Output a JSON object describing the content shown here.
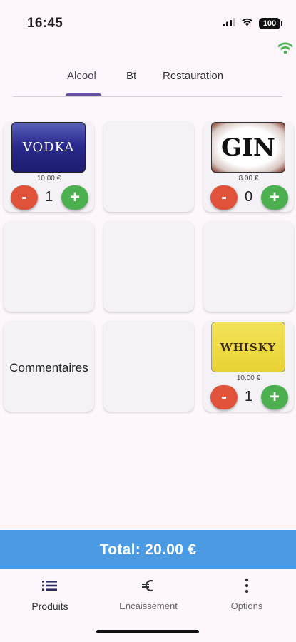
{
  "status_bar": {
    "time": "16:45",
    "battery": "100"
  },
  "tabs": [
    {
      "label": "Alcool",
      "active": true
    },
    {
      "label": "Bt",
      "active": false
    },
    {
      "label": "Restauration",
      "active": false
    }
  ],
  "products": {
    "vodka": {
      "image_text": "VODKA",
      "price": "10.00 €",
      "qty": "1"
    },
    "gin": {
      "image_text": "GIN",
      "price": "8.00 €",
      "qty": "0"
    },
    "whisky": {
      "image_text": "WHISKY",
      "price": "10.00 €",
      "qty": "1"
    },
    "comment_label": "Commentaires",
    "minus_label": "-",
    "plus_label": "+"
  },
  "total": {
    "label": "Total: 20.00 €"
  },
  "nav": [
    {
      "label": "Produits",
      "icon": "list-icon",
      "active": true
    },
    {
      "label": "Encaissement",
      "icon": "euro-icon",
      "active": false
    },
    {
      "label": "Options",
      "icon": "more-vert-icon",
      "active": false
    }
  ],
  "colors": {
    "background": "#fdf7fd",
    "tab_indicator": "#6750a4",
    "minus_button": "#e0533a",
    "plus_button": "#4caf50",
    "total_bar": "#4a9ae4",
    "online_indicator": "#4caf50"
  }
}
